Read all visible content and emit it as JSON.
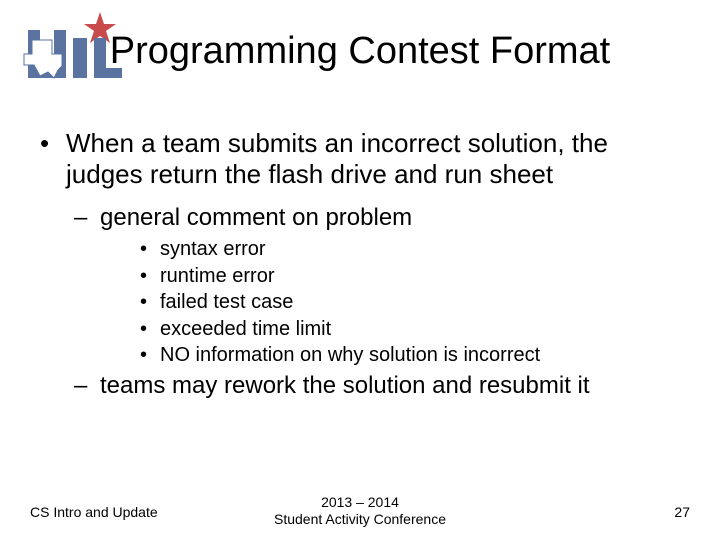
{
  "title": "Programming Contest Format",
  "bullets": {
    "l1": "When a team submits an incorrect solution, the judges return the flash drive and run sheet",
    "l2a": "general comment on problem",
    "l3": [
      "syntax error",
      "runtime error",
      "failed test case",
      "exceeded time limit",
      "NO information on why solution is incorrect"
    ],
    "l2b": "teams may rework the solution and resubmit it"
  },
  "footer": {
    "left": "CS Intro and Update",
    "center_line1": "2013 – 2014",
    "center_line2": "Student Activity Conference",
    "page": "27"
  },
  "logo": {
    "name": "UIL logo with Texas shape and star",
    "colors": {
      "blue": "#5a73a0",
      "red": "#c84b4b",
      "white": "#ffffff"
    }
  }
}
